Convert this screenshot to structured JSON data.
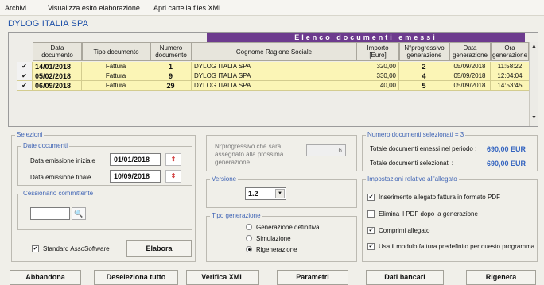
{
  "menu": [
    "Archivi",
    "Visualizza esito elaborazione",
    "Apri cartella files XML"
  ],
  "company": "DYLOG ITALIA SPA",
  "table": {
    "title": "Elenco documenti emessi",
    "headers": [
      "Data documento",
      "Tipo documento",
      "Numero documento",
      "Cognome Ragione Sociale",
      "Importo [Euro]",
      "N°progressivo generazione",
      "Data generazione",
      "Ora generazione"
    ],
    "rows": [
      {
        "checked": "✔",
        "date": "14/01/2018",
        "type": "Fattura",
        "num": "1",
        "name": "DYLOG ITALIA SPA",
        "amount": "320,00",
        "prog": "2",
        "gen_date": "05/09/2018",
        "gen_time": "11:58:22"
      },
      {
        "checked": "✔",
        "date": "05/02/2018",
        "type": "Fattura",
        "num": "9",
        "name": "DYLOG ITALIA SPA",
        "amount": "330,00",
        "prog": "4",
        "gen_date": "05/09/2018",
        "gen_time": "12:04:04"
      },
      {
        "checked": "✔",
        "date": "06/09/2018",
        "type": "Fattura",
        "num": "29",
        "name": "DYLOG ITALIA SPA",
        "amount": "40,00",
        "prog": "5",
        "gen_date": "05/09/2018",
        "gen_time": "14:53:45"
      }
    ]
  },
  "selezioni": {
    "title": "Selezioni",
    "date_group": "Date documenti",
    "start_label": "Data emissione iniziale",
    "start_value": "01/01/2018",
    "end_label": "Data emissione finale",
    "end_value": "10/09/2018",
    "cessionario_label": "Cessionario committente",
    "standard_label": "Standard AssoSoftware",
    "elabora": "Elabora"
  },
  "progressivo": {
    "label": "N°progressivo che sarà assegnato alla prossima generazione",
    "value": "6"
  },
  "versione": {
    "title": "Versione",
    "value": "1.2"
  },
  "tipo": {
    "title": "Tipo generazione",
    "options": [
      "Generazione definitiva",
      "Simulazione",
      "Rigenerazione"
    ]
  },
  "numero": {
    "title": "Numero documenti selezionati = 3",
    "periodo_label": "Totale documenti emessi nel periodo :",
    "periodo_value": "690,00 EUR",
    "selezionati_label": "Totale documenti selezionati :",
    "selezionati_value": "690,00 EUR"
  },
  "allegato": {
    "title": "Impostazioni relative all'allegato",
    "options": [
      {
        "label": "Inserimento allegato fattura in formato PDF",
        "checked": "✔"
      },
      {
        "label": "Elimina il PDF dopo la generazione",
        "checked": ""
      },
      {
        "label": "Comprimi allegato",
        "checked": "✔"
      },
      {
        "label": "Usa il modulo fattura predefinito per questo programma",
        "checked": "✔"
      }
    ]
  },
  "buttons": [
    "Abbandona",
    "Deseleziona tutto",
    "Verifica XML",
    "Parametri",
    "Dati bancari",
    "Rigenera"
  ],
  "colors": {
    "title_bar": "#6d3b8e",
    "row_bg": "#fbf5b6",
    "accent_blue": "#3464c0"
  }
}
